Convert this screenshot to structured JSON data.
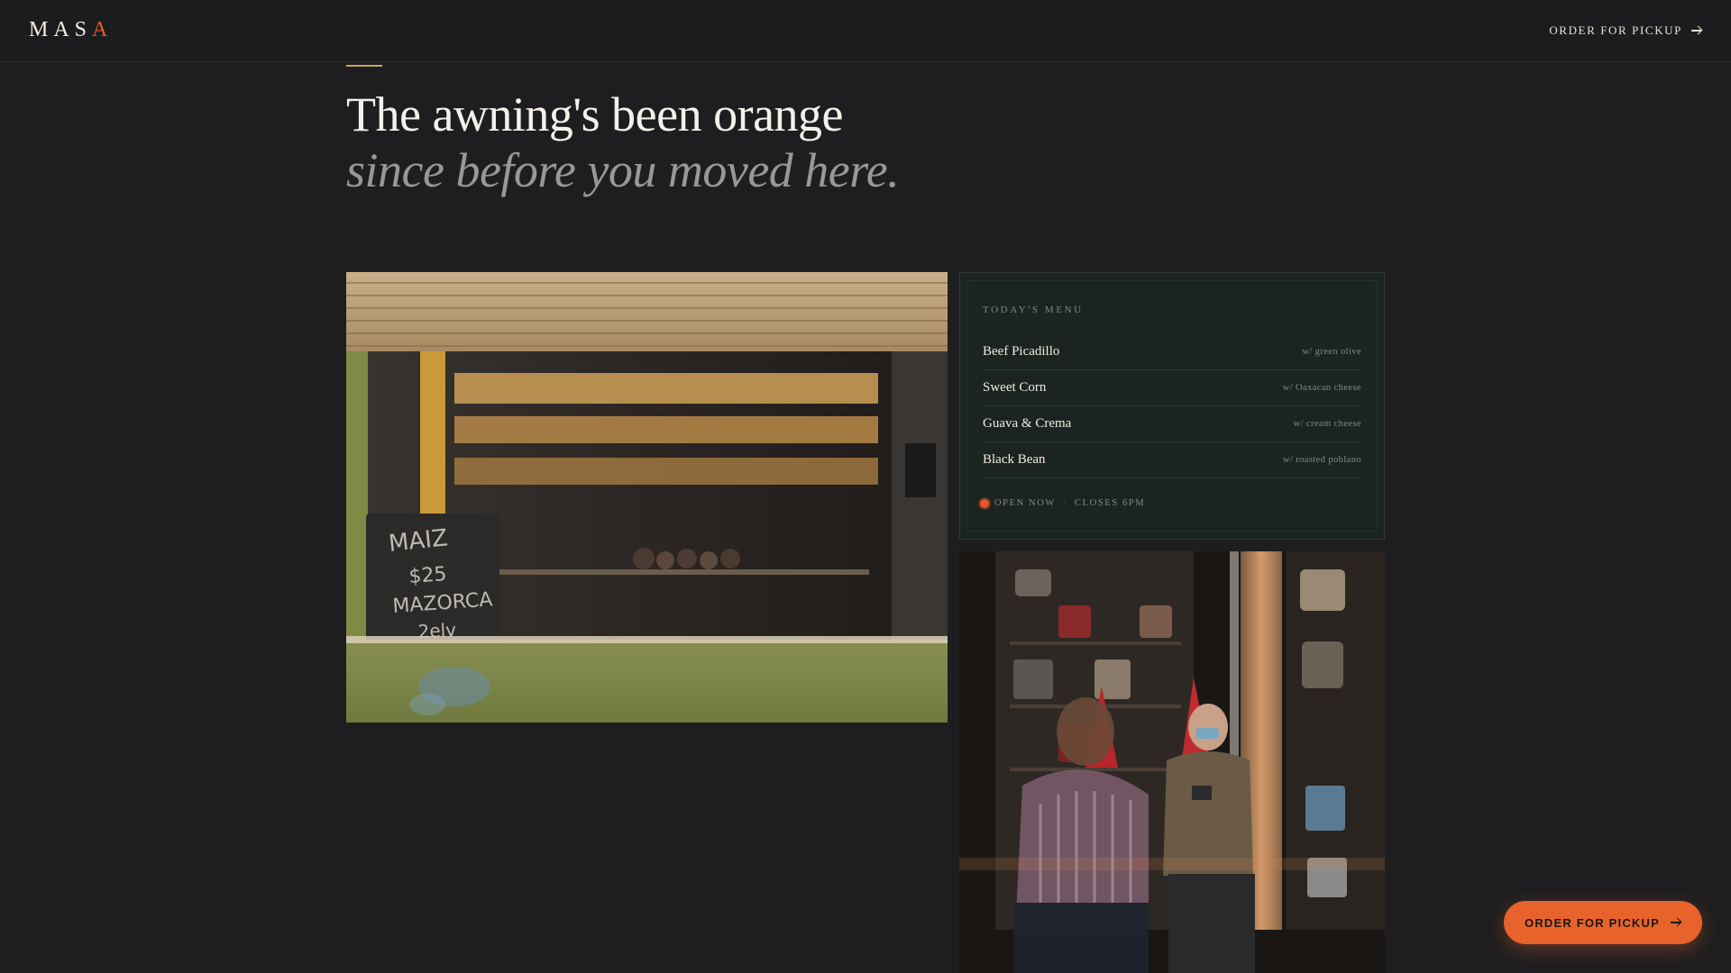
{
  "brand": {
    "logo_main": "MAS",
    "logo_accent": "A"
  },
  "header": {
    "cta_label": "ORDER FOR PICKUP"
  },
  "hero": {
    "headline": "The awning's been orange",
    "subline": "since before you moved here."
  },
  "photos": {
    "window_sign_lines": [
      "MAIZ",
      "$25",
      "MAZORCA",
      "2elv"
    ]
  },
  "menu": {
    "title": "TODAY'S MENU",
    "items": [
      {
        "name": "Beef Picadillo",
        "note": "w/ green olive"
      },
      {
        "name": "Sweet Corn",
        "note": "w/ Oaxacan cheese"
      },
      {
        "name": "Guava & Crema",
        "note": "w/ cream cheese"
      },
      {
        "name": "Black Bean",
        "note": "w/ roasted poblano"
      }
    ],
    "status_open": "OPEN NOW",
    "status_separator": "·",
    "status_close": "CLOSES 6PM"
  },
  "floating_cta": {
    "label": "ORDER FOR PICKUP"
  },
  "colors": {
    "background": "#1e1e20",
    "accent": "#e4572e",
    "cta": "#e8632c",
    "menu_card": "#1b2421",
    "rule": "#c9a76a"
  },
  "icons": {
    "cta_arrow": "arrow-right-icon",
    "status_dot": "open-status-dot-icon"
  }
}
